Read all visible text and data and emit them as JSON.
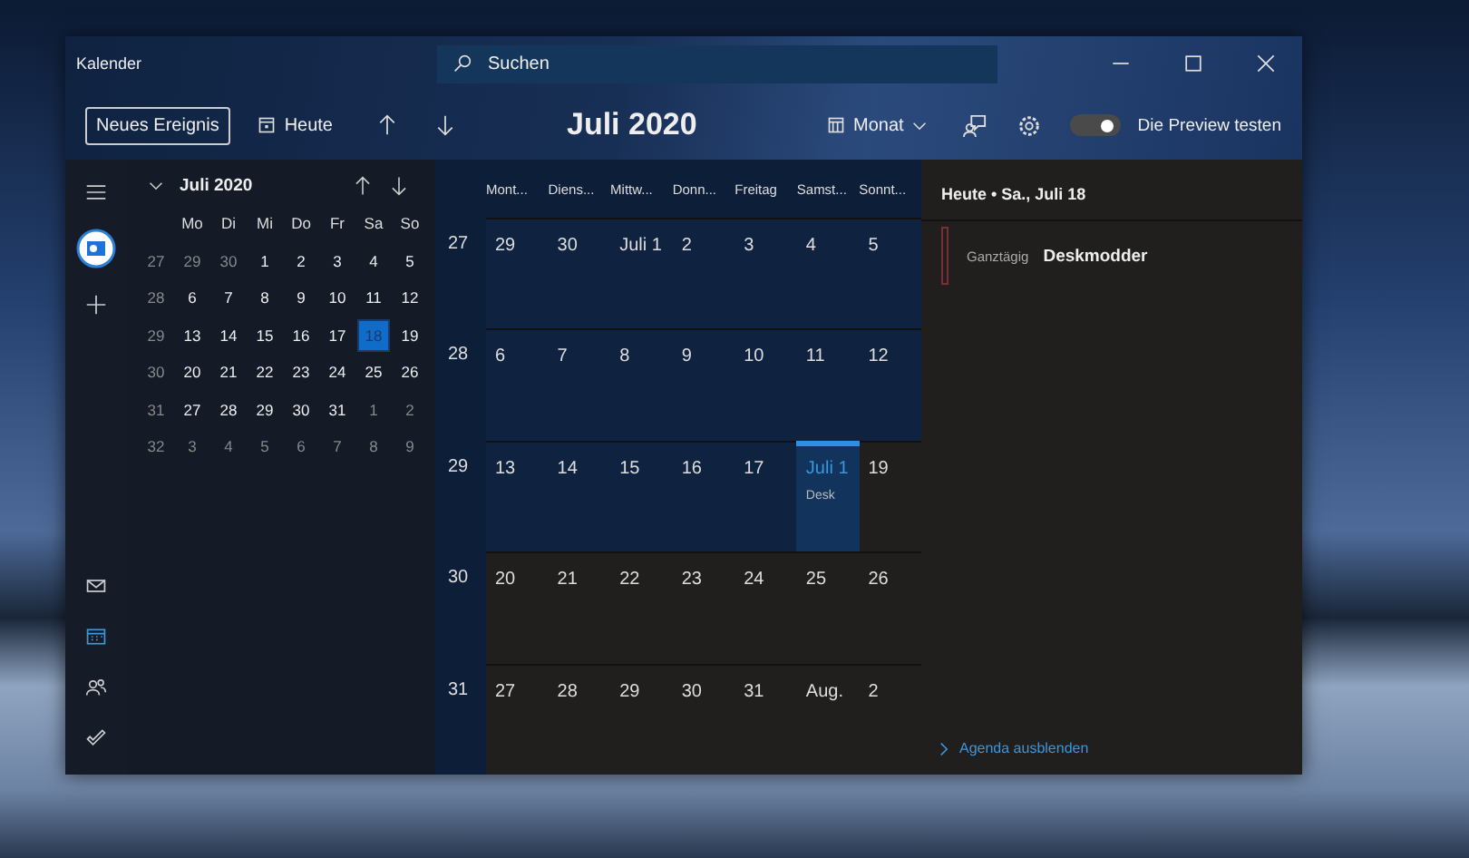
{
  "window": {
    "title": "Kalender"
  },
  "search": {
    "placeholder": "Suchen"
  },
  "toolbar": {
    "new_event": "Neues Ereignis",
    "today": "Heute",
    "title": "Juli 2020",
    "view": "Monat",
    "preview": {
      "label": "Die Preview testen",
      "on": true
    }
  },
  "rail": {
    "top": [
      {
        "kind": "menu"
      },
      {
        "kind": "account"
      },
      {
        "kind": "add"
      }
    ],
    "bottom": [
      {
        "kind": "mail",
        "selected": false
      },
      {
        "kind": "calendar",
        "selected": true
      },
      {
        "kind": "people",
        "selected": false
      },
      {
        "kind": "todo",
        "selected": false
      }
    ]
  },
  "mini_calendar": {
    "title": "Juli 2020",
    "weekdays": [
      "Mo",
      "Di",
      "Mi",
      "Do",
      "Fr",
      "Sa",
      "So"
    ],
    "weeks": [
      {
        "number": "27",
        "days": [
          {
            "label": "29",
            "in_month": false,
            "selected": false
          },
          {
            "label": "30",
            "in_month": false,
            "selected": false
          },
          {
            "label": "1",
            "in_month": true,
            "selected": false
          },
          {
            "label": "2",
            "in_month": true,
            "selected": false
          },
          {
            "label": "3",
            "in_month": true,
            "selected": false
          },
          {
            "label": "4",
            "in_month": true,
            "selected": false
          },
          {
            "label": "5",
            "in_month": true,
            "selected": false
          }
        ]
      },
      {
        "number": "28",
        "days": [
          {
            "label": "6",
            "in_month": true,
            "selected": false
          },
          {
            "label": "7",
            "in_month": true,
            "selected": false
          },
          {
            "label": "8",
            "in_month": true,
            "selected": false
          },
          {
            "label": "9",
            "in_month": true,
            "selected": false
          },
          {
            "label": "10",
            "in_month": true,
            "selected": false
          },
          {
            "label": "11",
            "in_month": true,
            "selected": false
          },
          {
            "label": "12",
            "in_month": true,
            "selected": false
          }
        ]
      },
      {
        "number": "29",
        "days": [
          {
            "label": "13",
            "in_month": true,
            "selected": false
          },
          {
            "label": "14",
            "in_month": true,
            "selected": false
          },
          {
            "label": "15",
            "in_month": true,
            "selected": false
          },
          {
            "label": "16",
            "in_month": true,
            "selected": false
          },
          {
            "label": "17",
            "in_month": true,
            "selected": false
          },
          {
            "label": "18",
            "in_month": true,
            "selected": true
          },
          {
            "label": "19",
            "in_month": true,
            "selected": false
          }
        ]
      },
      {
        "number": "30",
        "days": [
          {
            "label": "20",
            "in_month": true,
            "selected": false
          },
          {
            "label": "21",
            "in_month": true,
            "selected": false
          },
          {
            "label": "22",
            "in_month": true,
            "selected": false
          },
          {
            "label": "23",
            "in_month": true,
            "selected": false
          },
          {
            "label": "24",
            "in_month": true,
            "selected": false
          },
          {
            "label": "25",
            "in_month": true,
            "selected": false
          },
          {
            "label": "26",
            "in_month": true,
            "selected": false
          }
        ]
      },
      {
        "number": "31",
        "days": [
          {
            "label": "27",
            "in_month": true,
            "selected": false
          },
          {
            "label": "28",
            "in_month": true,
            "selected": false
          },
          {
            "label": "29",
            "in_month": true,
            "selected": false
          },
          {
            "label": "30",
            "in_month": true,
            "selected": false
          },
          {
            "label": "31",
            "in_month": true,
            "selected": false
          },
          {
            "label": "1",
            "in_month": false,
            "selected": false
          },
          {
            "label": "2",
            "in_month": false,
            "selected": false
          }
        ]
      },
      {
        "number": "32",
        "days": [
          {
            "label": "3",
            "in_month": false,
            "selected": false
          },
          {
            "label": "4",
            "in_month": false,
            "selected": false
          },
          {
            "label": "5",
            "in_month": false,
            "selected": false
          },
          {
            "label": "6",
            "in_month": false,
            "selected": false
          },
          {
            "label": "7",
            "in_month": false,
            "selected": false
          },
          {
            "label": "8",
            "in_month": false,
            "selected": false
          },
          {
            "label": "9",
            "in_month": false,
            "selected": false
          }
        ]
      }
    ]
  },
  "month": {
    "columns": [
      "Mont...",
      "Diens...",
      "Mittw...",
      "Donn...",
      "Freitag",
      "Samst...",
      "Sonnt..."
    ],
    "weeks": [
      {
        "number": "27",
        "days": [
          {
            "label": "29",
            "past": true,
            "today": false
          },
          {
            "label": "30",
            "past": true,
            "today": false
          },
          {
            "label": "Juli 1",
            "past": true,
            "today": false
          },
          {
            "label": "2",
            "past": true,
            "today": false
          },
          {
            "label": "3",
            "past": true,
            "today": false
          },
          {
            "label": "4",
            "past": true,
            "today": false
          },
          {
            "label": "5",
            "past": true,
            "today": false
          }
        ]
      },
      {
        "number": "28",
        "days": [
          {
            "label": "6",
            "past": true,
            "today": false
          },
          {
            "label": "7",
            "past": true,
            "today": false
          },
          {
            "label": "8",
            "past": true,
            "today": false
          },
          {
            "label": "9",
            "past": true,
            "today": false
          },
          {
            "label": "10",
            "past": true,
            "today": false
          },
          {
            "label": "11",
            "past": true,
            "today": false
          },
          {
            "label": "12",
            "past": true,
            "today": false
          }
        ]
      },
      {
        "number": "29",
        "days": [
          {
            "label": "13",
            "past": true,
            "today": false
          },
          {
            "label": "14",
            "past": true,
            "today": false
          },
          {
            "label": "15",
            "past": true,
            "today": false
          },
          {
            "label": "16",
            "past": true,
            "today": false
          },
          {
            "label": "17",
            "past": true,
            "today": false
          },
          {
            "label": "Juli 1",
            "past": false,
            "today": true,
            "events": [
              "Desk"
            ]
          },
          {
            "label": "19",
            "past": false,
            "today": false
          }
        ]
      },
      {
        "number": "30",
        "days": [
          {
            "label": "20",
            "past": false,
            "today": false
          },
          {
            "label": "21",
            "past": false,
            "today": false
          },
          {
            "label": "22",
            "past": false,
            "today": false
          },
          {
            "label": "23",
            "past": false,
            "today": false
          },
          {
            "label": "24",
            "past": false,
            "today": false
          },
          {
            "label": "25",
            "past": false,
            "today": false
          },
          {
            "label": "26",
            "past": false,
            "today": false
          }
        ]
      },
      {
        "number": "31",
        "days": [
          {
            "label": "27",
            "past": false,
            "today": false
          },
          {
            "label": "28",
            "past": false,
            "today": false
          },
          {
            "label": "29",
            "past": false,
            "today": false
          },
          {
            "label": "30",
            "past": false,
            "today": false
          },
          {
            "label": "31",
            "past": false,
            "today": false
          },
          {
            "label": "Aug.",
            "past": false,
            "today": false
          },
          {
            "label": "2",
            "past": false,
            "today": false
          }
        ]
      }
    ]
  },
  "agenda": {
    "header": "Heute • Sa., Juli 18",
    "events": [
      {
        "time": "Ganztägig",
        "title": "Deskmodder",
        "color": "#7a2e36"
      }
    ],
    "hide_link": "Agenda ausblenden"
  }
}
